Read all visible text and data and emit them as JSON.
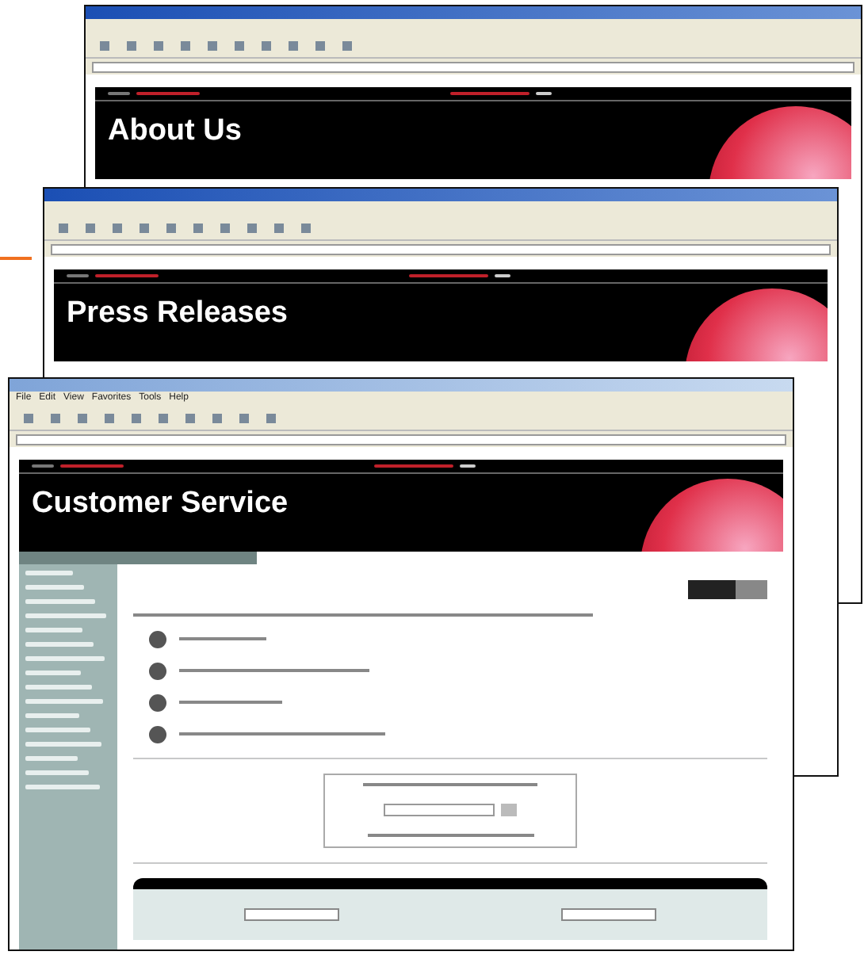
{
  "windows": [
    {
      "active": false,
      "page_title": "About Us"
    },
    {
      "active": false,
      "page_title": "Press Releases"
    },
    {
      "active": true,
      "page_title": "Customer Service",
      "menu": [
        "File",
        "Edit",
        "View",
        "Favorites",
        "Tools",
        "Help"
      ]
    }
  ]
}
